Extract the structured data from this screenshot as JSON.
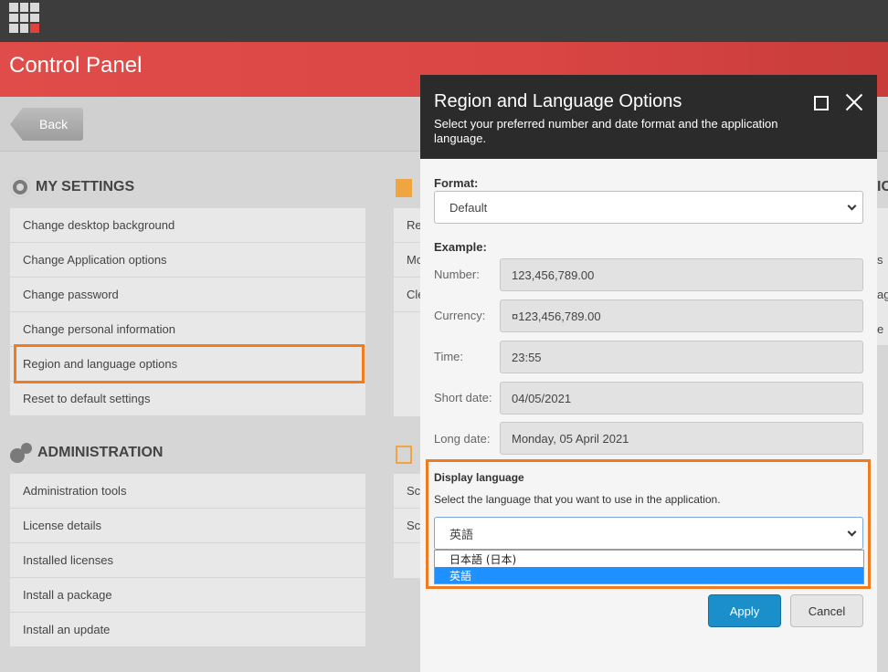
{
  "app": {
    "title": "Control Panel",
    "back_label": "Back"
  },
  "my_settings": {
    "title": "MY SETTINGS",
    "items": [
      "Change desktop background",
      "Change Application options",
      "Change password",
      "Change personal information",
      "Region and language options",
      "Reset to default settings"
    ]
  },
  "administration": {
    "title": "ADMINISTRATION",
    "items": [
      "Administration tools",
      "License details",
      "Installed licenses",
      "Install a package",
      "Install an update"
    ]
  },
  "middle": {
    "items_top": [
      "Re",
      "Mo",
      "Cle"
    ],
    "items_bottom": [
      "Sca",
      "Sca"
    ]
  },
  "right_edge": {
    "heading": "IC",
    "rows": [
      "s",
      "ag",
      "e"
    ]
  },
  "dialog": {
    "title": "Region and Language Options",
    "subtitle": "Select your preferred number and date format and the application language.",
    "format_label": "Format:",
    "format_value": "Default",
    "example_label": "Example:",
    "examples": [
      {
        "label": "Number:",
        "value": "123,456,789.00"
      },
      {
        "label": "Currency:",
        "value": "¤123,456,789.00"
      },
      {
        "label": "Time:",
        "value": "23:55"
      },
      {
        "label": "Short date:",
        "value": "04/05/2021"
      },
      {
        "label": "Long date:",
        "value": "Monday, 05 April 2021"
      }
    ],
    "display_language_label": "Display language",
    "display_language_hint": "Select the language that you want to use in the application.",
    "language_value": "英語",
    "language_options": [
      "日本語 (日本)",
      "英語"
    ],
    "apply_label": "Apply",
    "cancel_label": "Cancel"
  },
  "colors": {
    "accent": "#1b8fca",
    "highlight": "#f07c1f",
    "banner": "#d94644"
  }
}
